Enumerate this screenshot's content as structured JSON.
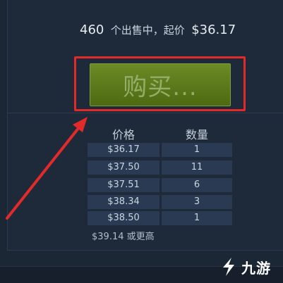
{
  "listing_summary": {
    "count": "460",
    "count_suffix": "个出售中，起价",
    "lowest_price": "$36.17"
  },
  "buy_button": {
    "label": "购买..."
  },
  "order_table": {
    "headers": {
      "price": "价格",
      "quantity": "数量"
    },
    "rows": [
      {
        "price": "$36.17",
        "quantity": "1"
      },
      {
        "price": "$37.50",
        "quantity": "11"
      },
      {
        "price": "$37.51",
        "quantity": "6"
      },
      {
        "price": "$38.34",
        "quantity": "3"
      },
      {
        "price": "$38.50",
        "quantity": "1"
      }
    ],
    "more_text": "$39.14 或更高"
  },
  "watermark": {
    "text": "九游"
  },
  "colors": {
    "background": "#1c2736",
    "button_green": "#5b7a1a",
    "highlight_red": "#e22a2a",
    "cell_bg": "#2a3a52"
  }
}
